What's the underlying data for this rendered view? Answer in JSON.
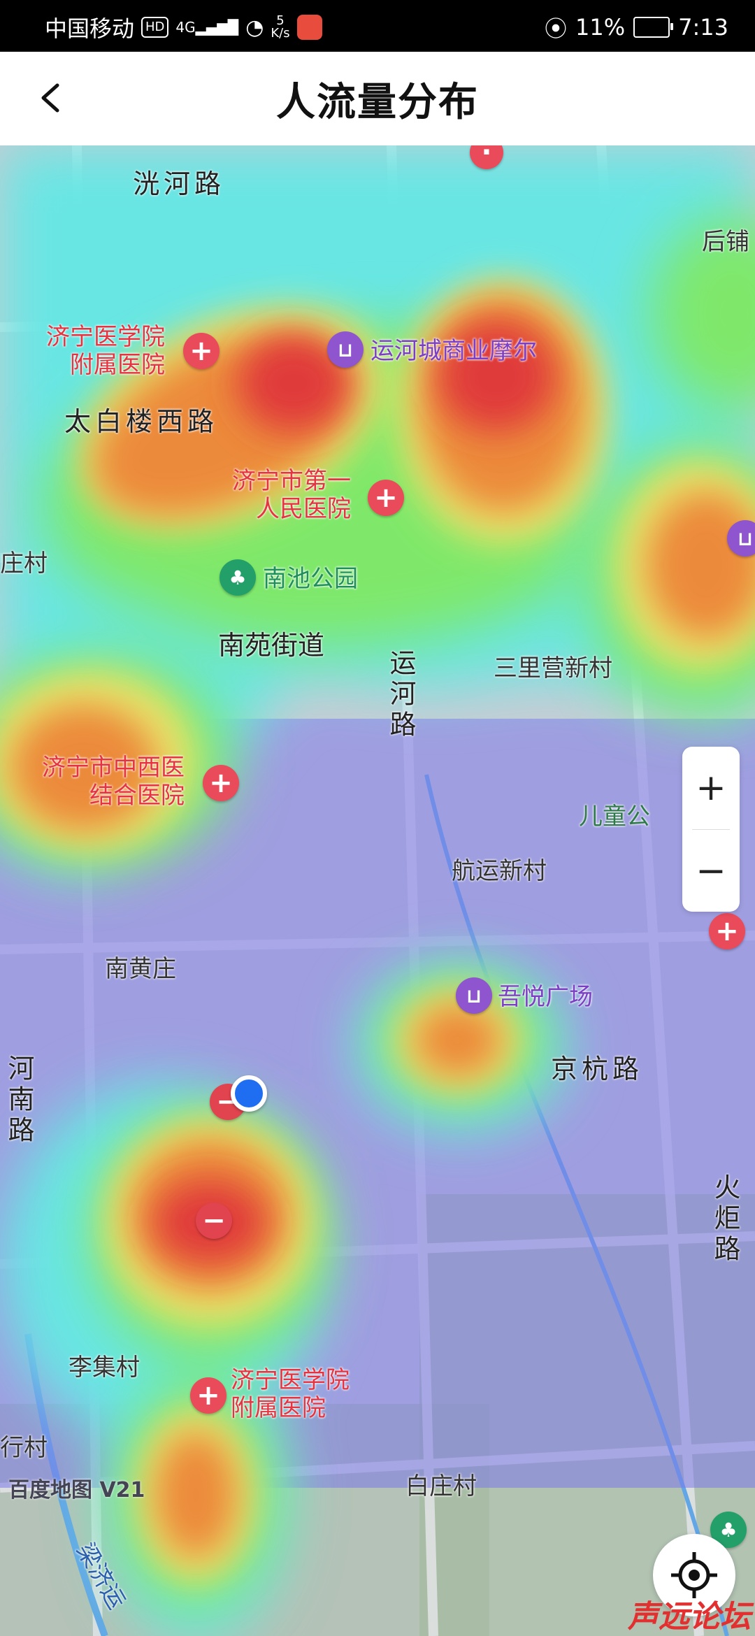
{
  "status_bar": {
    "carrier": "中国移动",
    "hd": "HD",
    "signal": "4G",
    "speed_top": "5",
    "speed_bottom": "K/s",
    "battery_percent": "11%",
    "time": "7:13"
  },
  "header": {
    "title": "人流量分布"
  },
  "map": {
    "roads": {
      "r1": "洸河路",
      "r2": "太白楼西路",
      "r3": "运河路",
      "r4": "京杭路",
      "r5": "火炬路",
      "r6": "河南路",
      "r7": "梁济运"
    },
    "areas": {
      "a1": "南苑街道",
      "a2": "三里营新村",
      "a3": "航运新村",
      "a4": "南黄庄",
      "a5": "李集村",
      "a6": "白庄村",
      "a7": "后铺",
      "a8": "庄村",
      "a9": "行村",
      "a10": "儿童公"
    },
    "pois": {
      "hosp1": "济宁医学院\n附属医院",
      "hosp2": "济宁市第一\n人民医院",
      "hosp3": "济宁市中西医\n结合医院",
      "hosp4": "济宁医学院\n附属医院",
      "mall1": "运河城商业摩尔",
      "mall2": "吾悦广场",
      "park1": "南池公园"
    },
    "watermark": "百度地图 V21"
  },
  "controls": {
    "zoom_in": "+",
    "zoom_out": "−"
  },
  "forum_mark": "声远论坛"
}
